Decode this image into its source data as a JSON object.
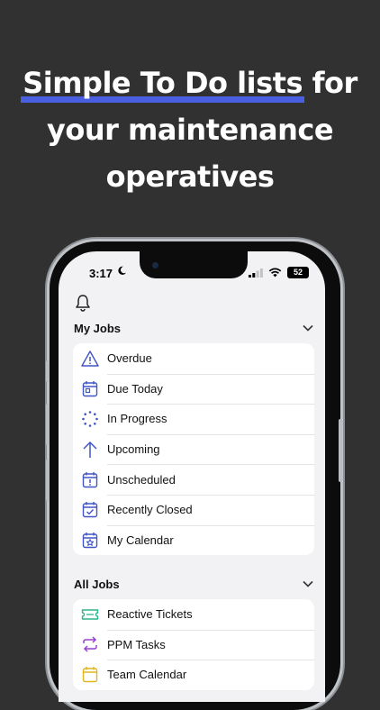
{
  "headline": {
    "highlight": "Simple To Do lists",
    "rest_line1": " for",
    "line2": "your maintenance",
    "line3": "operatives"
  },
  "status_bar": {
    "time": "3:17",
    "battery": "52"
  },
  "colors": {
    "background": "#313131",
    "highlight": "#4a5fe0",
    "icon_blue": "#3f55c6",
    "ticket_green": "#2bb58a",
    "ppm_purple": "#9b3fd1",
    "calendar_yellow": "#e0b520"
  },
  "my_jobs": {
    "title": "My Jobs",
    "items": [
      {
        "label": "Overdue",
        "icon": "warning-icon"
      },
      {
        "label": "Due Today",
        "icon": "calendar-today-icon"
      },
      {
        "label": "In Progress",
        "icon": "progress-icon"
      },
      {
        "label": "Upcoming",
        "icon": "arrow-up-icon"
      },
      {
        "label": "Unscheduled",
        "icon": "calendar-alert-icon"
      },
      {
        "label": "Recently Closed",
        "icon": "calendar-check-icon"
      },
      {
        "label": "My Calendar",
        "icon": "calendar-star-icon"
      }
    ]
  },
  "all_jobs": {
    "title": "All Jobs",
    "items": [
      {
        "label": "Reactive Tickets",
        "icon": "ticket-icon"
      },
      {
        "label": "PPM Tasks",
        "icon": "repeat-icon"
      },
      {
        "label": "Team Calendar",
        "icon": "team-calendar-icon"
      }
    ]
  }
}
